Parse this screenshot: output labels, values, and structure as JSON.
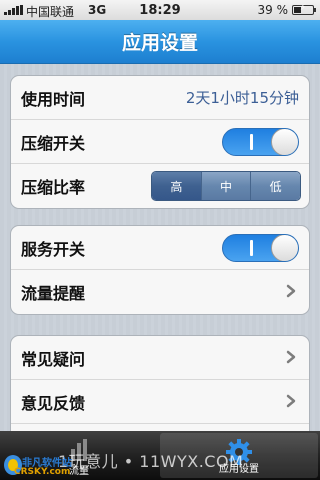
{
  "status_bar": {
    "carrier": "中国联通",
    "network": "3G",
    "time": "18:29",
    "battery_percent_text": "39 %",
    "battery_level": 0.39
  },
  "nav": {
    "title": "应用设置"
  },
  "group1": {
    "usage_time_label": "使用时间",
    "usage_time_value": "2天1小时15分钟",
    "compress_switch_label": "压缩开关",
    "compress_switch_on": true,
    "compress_ratio_label": "压缩比率",
    "compress_ratio_options": [
      "高",
      "中",
      "低"
    ],
    "compress_ratio_selected": "高"
  },
  "group2": {
    "service_switch_label": "服务开关",
    "service_switch_on": true,
    "traffic_alert_label": "流量提醒"
  },
  "group3": {
    "faq_label": "常见疑问",
    "feedback_label": "意见反馈"
  },
  "tab_bar": {
    "tabs": [
      {
        "label": "流量",
        "icon": "chart-bars-icon",
        "selected": false
      },
      {
        "label": "应用设置",
        "icon": "gear-icon",
        "selected": true
      }
    ]
  },
  "overlay": {
    "watermark": "1玩意儿 • 11WYX.COM",
    "logo_cn": "非凡软件站",
    "logo_en": "CRSKY.com"
  },
  "colors": {
    "nav_blue": "#2a93e0",
    "toggle_blue": "#1f7fe0",
    "value_text": "#3c5f96",
    "segment_selected": "#3f6190"
  }
}
